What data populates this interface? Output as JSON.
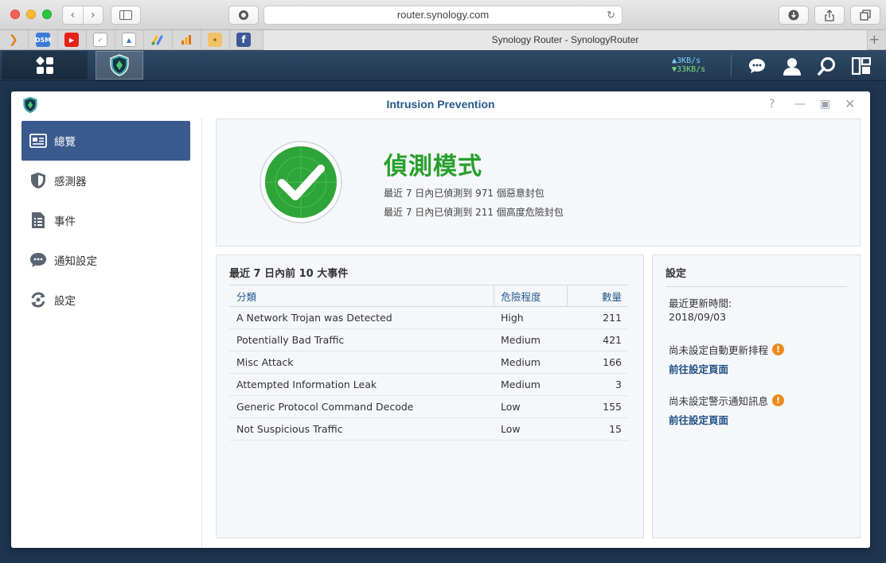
{
  "browser": {
    "url": "router.synology.com",
    "tab_title": "Synology Router - SynologyRouter"
  },
  "taskbar": {
    "upload_speed": "3KB/s",
    "download_speed": "33KB/s"
  },
  "window": {
    "title": "Intrusion Prevention"
  },
  "sidebar": {
    "items": [
      {
        "label": "總覽",
        "icon": "overview-card-icon"
      },
      {
        "label": "感測器",
        "icon": "shield-icon"
      },
      {
        "label": "事件",
        "icon": "list-document-icon"
      },
      {
        "label": "通知設定",
        "icon": "chat-bubble-icon"
      },
      {
        "label": "設定",
        "icon": "refresh-gear-icon"
      }
    ]
  },
  "status": {
    "mode": "偵測模式",
    "line1": "最近 7 日內已偵測到 971 個惡意封包",
    "line2": "最近 7 日內已偵測到 211 個高度危險封包"
  },
  "events": {
    "title": "最近 7 日內前 10 大事件",
    "columns": [
      "分類",
      "危險程度",
      "數量"
    ],
    "rows": [
      {
        "category": "A Network Trojan was Detected",
        "severity": "High",
        "count": "211"
      },
      {
        "category": "Potentially Bad Traffic",
        "severity": "Medium",
        "count": "421"
      },
      {
        "category": "Misc Attack",
        "severity": "Medium",
        "count": "166"
      },
      {
        "category": "Attempted Information Leak",
        "severity": "Medium",
        "count": "3"
      },
      {
        "category": "Generic Protocol Command Decode",
        "severity": "Low",
        "count": "155"
      },
      {
        "category": "Not Suspicious Traffic",
        "severity": "Low",
        "count": "15"
      }
    ]
  },
  "settings": {
    "title": "設定",
    "last_update_label": "最近更新時間:",
    "last_update_value": "2018/09/03",
    "auto_update_warning": "尚未設定自動更新排程",
    "alert_warning": "尚未設定警示通知訊息",
    "goto_link": "前往設定頁面"
  },
  "colors": {
    "accent": "#3a5a8e",
    "success": "#27a02d",
    "warning": "#ec8a1c"
  }
}
